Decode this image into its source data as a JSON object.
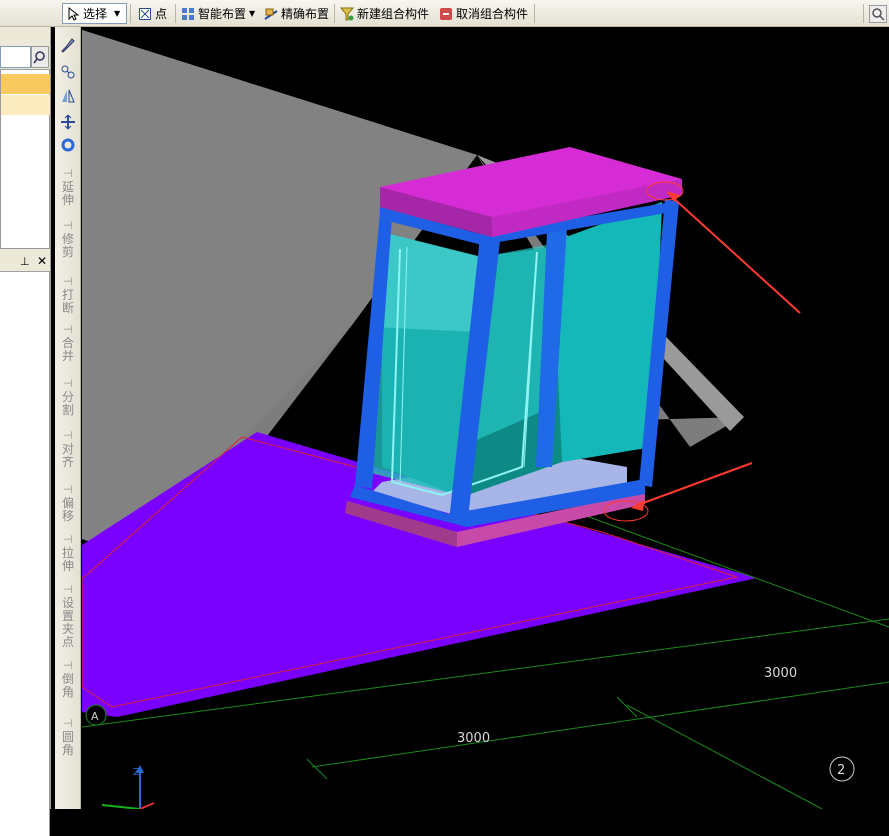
{
  "toolbar": {
    "select_label": "选择",
    "point_label": "点",
    "smart_layout_label": "智能布置",
    "precise_layout_label": "精确布置",
    "new_group_label": "新建组合构件",
    "cancel_group_label": "取消组合构件"
  },
  "side_toolbar": {
    "tools": [
      {
        "label": "延伸"
      },
      {
        "label": "修剪"
      },
      {
        "label": "打断"
      },
      {
        "label": "合并"
      },
      {
        "label": "分割"
      },
      {
        "label": "对齐"
      },
      {
        "label": "偏移"
      },
      {
        "label": "拉伸"
      },
      {
        "label": "设置夹点"
      },
      {
        "label": "倒角"
      },
      {
        "label": "圆角"
      }
    ]
  },
  "viewport": {
    "dimensions": [
      "3000",
      "3000"
    ],
    "axis_labels": {
      "a": "A",
      "two": "2"
    },
    "axis_letter_z": "Z",
    "colors": {
      "roof": "#7d7d7d",
      "slab": "#7a00ff",
      "window_frame": "#1f5fe6",
      "glass": "#20c8c8",
      "top_cap": "#d52cd6",
      "arrow": "#ff3b30",
      "grid_line": "#1a8a1a"
    }
  }
}
